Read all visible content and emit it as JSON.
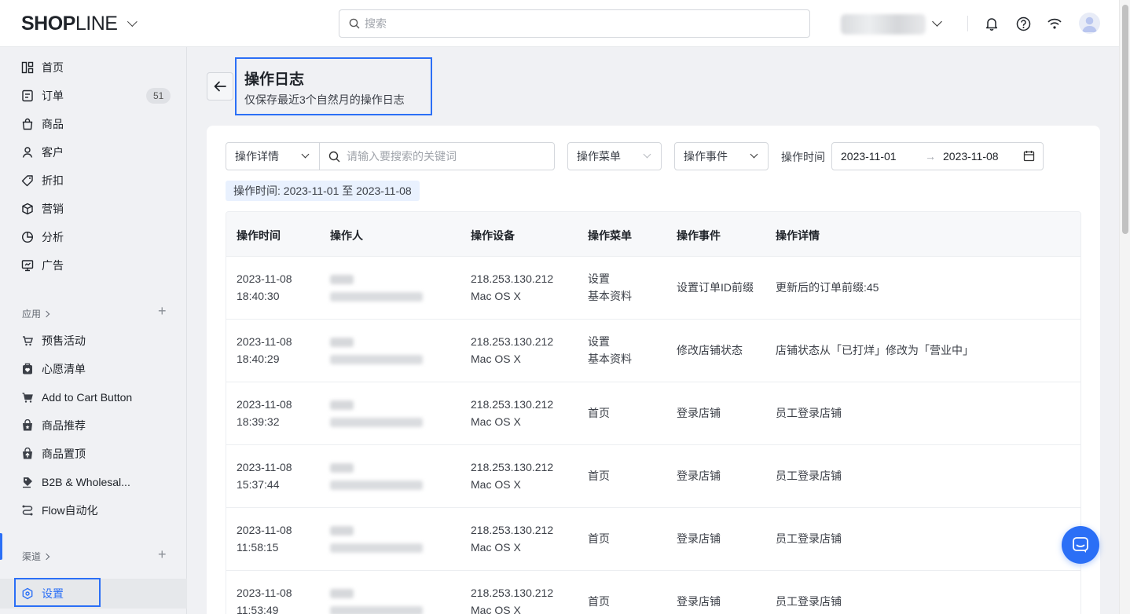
{
  "header": {
    "logo_bold": "SHOP",
    "logo_thin": "LINE",
    "search_placeholder": "搜索"
  },
  "sidebar": {
    "items": [
      {
        "label": "首页",
        "icon": "grid-icon"
      },
      {
        "label": "订单",
        "icon": "order-icon",
        "badge": "51"
      },
      {
        "label": "商品",
        "icon": "bag-icon"
      },
      {
        "label": "客户",
        "icon": "user-icon"
      },
      {
        "label": "折扣",
        "icon": "tag-icon"
      },
      {
        "label": "营销",
        "icon": "cube-icon"
      },
      {
        "label": "分析",
        "icon": "pie-icon"
      },
      {
        "label": "广告",
        "icon": "ad-icon"
      }
    ],
    "apps_label": "应用",
    "apps": [
      {
        "label": "预售活动",
        "icon": "presale-icon"
      },
      {
        "label": "心愿清单",
        "icon": "wishlist-icon"
      },
      {
        "label": "Add to Cart Button",
        "icon": "cart-icon"
      },
      {
        "label": "商品推荐",
        "icon": "recommend-icon"
      },
      {
        "label": "商品置顶",
        "icon": "pin-icon"
      },
      {
        "label": "B2B & Wholesal...",
        "icon": "b2b-icon"
      },
      {
        "label": "Flow自动化",
        "icon": "flow-icon"
      }
    ],
    "channels_label": "渠道",
    "settings_label": "设置"
  },
  "page": {
    "title": "操作日志",
    "subtitle": "仅保存最近3个自然月的操作日志"
  },
  "filters": {
    "detail_select": "操作详情",
    "keyword_placeholder": "请输入要搜索的关键词",
    "menu_select": "操作菜单",
    "event_select": "操作事件",
    "time_label": "操作时间",
    "date_start": "2023-11-01",
    "date_arrow": "→",
    "date_end": "2023-11-08",
    "active_tag": "操作时间: 2023-11-01 至 2023-11-08"
  },
  "table": {
    "headers": [
      "操作时间",
      "操作人",
      "操作设备",
      "操作菜单",
      "操作事件",
      "操作详情"
    ],
    "rows": [
      {
        "date": "2023-11-08",
        "time": "18:40:30",
        "ip": "218.253.130.212",
        "os": "Mac OS X",
        "menu1": "设置",
        "menu2": "基本资料",
        "event": "设置订单ID前缀",
        "detail": "更新后的订单前缀:45"
      },
      {
        "date": "2023-11-08",
        "time": "18:40:29",
        "ip": "218.253.130.212",
        "os": "Mac OS X",
        "menu1": "设置",
        "menu2": "基本资料",
        "event": "修改店铺状态",
        "detail": "店铺状态从「已打烊」修改为「营业中」"
      },
      {
        "date": "2023-11-08",
        "time": "18:39:32",
        "ip": "218.253.130.212",
        "os": "Mac OS X",
        "menu1": "首页",
        "menu2": "",
        "event": "登录店铺",
        "detail": "员工登录店铺"
      },
      {
        "date": "2023-11-08",
        "time": "15:37:44",
        "ip": "218.253.130.212",
        "os": "Mac OS X",
        "menu1": "首页",
        "menu2": "",
        "event": "登录店铺",
        "detail": "员工登录店铺"
      },
      {
        "date": "2023-11-08",
        "time": "11:58:15",
        "ip": "218.253.130.212",
        "os": "Mac OS X",
        "menu1": "首页",
        "menu2": "",
        "event": "登录店铺",
        "detail": "员工登录店铺"
      },
      {
        "date": "2023-11-08",
        "time": "11:53:49",
        "ip": "218.253.130.212",
        "os": "Mac OS X",
        "menu1": "首页",
        "menu2": "",
        "event": "登录店铺",
        "detail": "员工登录店铺"
      }
    ]
  },
  "colors": {
    "accent": "#2b6ff6",
    "sidebar_bg": "#f0f1f4",
    "tag_bg": "#e9f1fe"
  }
}
